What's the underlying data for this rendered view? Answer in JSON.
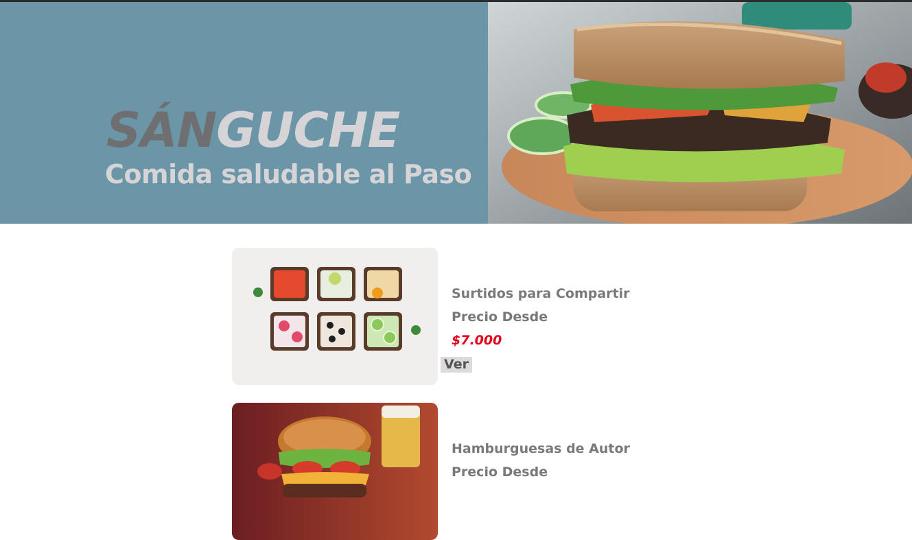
{
  "hero": {
    "brand_part_1": "SÁN",
    "brand_part_2": "GUCHE",
    "tagline": "Comida saludable al Paso",
    "colors": {
      "panel": "#6b96a8",
      "brand_dark": "#6f6f72",
      "brand_light": "#d6d4d6"
    },
    "photo_icon": "sandwich-photo"
  },
  "products": [
    {
      "title": "Surtidos para Compartir",
      "price_label": "Precio Desde",
      "price": "$7.000",
      "button_label": "Ver",
      "image_icon": "toast-assortment-photo"
    },
    {
      "title": "Hamburguesas de Autor",
      "price_label": "Precio Desde",
      "image_icon": "burger-photo"
    }
  ],
  "colors": {
    "price": "#e3001b",
    "text": "#78797b",
    "button_bg": "#dcdadb"
  }
}
